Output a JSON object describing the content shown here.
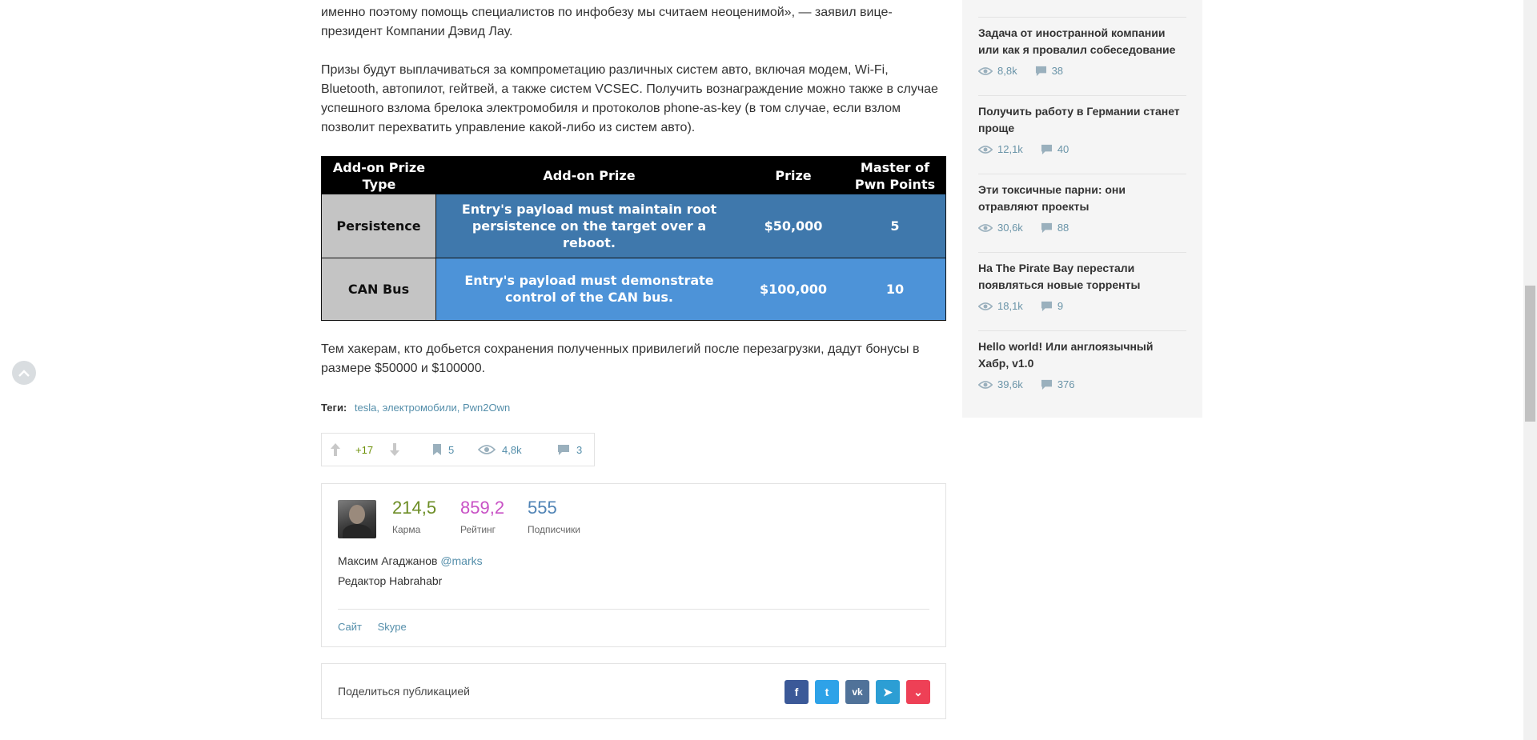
{
  "article": {
    "paragraph_1": "именно поэтому помощь специалистов по инфобезу мы считаем неоценимой», — заявил вице-президент Компании Дэвид Лау.",
    "paragraph_2": "Призы будут выплачиваться за компрометацию различных систем авто, включая модем, Wi-Fi, Bluetooth, автопилот, гейтвей, а также систем VCSEC. Получить вознаграждение можно также в случае успешного взлома брелока электромобиля и протоколов phone-as-key (в том случае, если взлом позволит перехватить управление какой-либо из систем авто).",
    "paragraph_3": "Тем хакерам, кто добьется сохранения полученных привилегий после перезагрузки, дадут бонусы в размере $50000 и $100000.",
    "table": {
      "headers": [
        "Add-on Prize Type",
        "Add-on Prize",
        "Prize",
        "Master of Pwn Points"
      ],
      "rows": [
        [
          "Persistence",
          "Entry's payload must maintain root persistence on the target over a reboot.",
          "$50,000",
          "5"
        ],
        [
          "CAN Bus",
          "Entry's payload must demonstrate control of the CAN bus.",
          "$100,000",
          "10"
        ]
      ]
    },
    "tags_label": "Теги:",
    "tags": [
      "tesla,",
      "электромобили,",
      "Pwn2Own"
    ],
    "stats": {
      "votes": "+17",
      "bookmarks": "5",
      "views": "4,8k",
      "comments": "3"
    }
  },
  "author": {
    "karma": "214,5",
    "karma_label": "Карма",
    "rating": "859,2",
    "rating_label": "Рейтинг",
    "followers": "555",
    "followers_label": "Подписчики",
    "name": "Максим Агаджанов",
    "handle": "@marks",
    "role": "Редактор Habrahabr",
    "links": [
      "Сайт",
      "Skype"
    ]
  },
  "share": {
    "label": "Поделиться публикацией",
    "buttons": [
      {
        "icon": "facebook-icon",
        "glyph": "f",
        "color": "#3b5998"
      },
      {
        "icon": "twitter-icon",
        "glyph": "t",
        "color": "#2ea2e8"
      },
      {
        "icon": "vk-icon",
        "glyph": "vk",
        "color": "#507299"
      },
      {
        "icon": "telegram-icon",
        "glyph": "➤",
        "color": "#2c9ed4"
      },
      {
        "icon": "pocket-icon",
        "glyph": "⌄",
        "color": "#ee4056"
      }
    ]
  },
  "sidebar": {
    "items": [
      {
        "title": "Задача от иностранной компании или как я провалил собеседование",
        "views": "8,8k",
        "comments": "38"
      },
      {
        "title": "Получить работу в Германии станет проще",
        "views": "12,1k",
        "comments": "40"
      },
      {
        "title": "Эти токсичные парни: они отравляют проекты",
        "views": "30,6k",
        "comments": "88"
      },
      {
        "title": "На The Pirate Bay перестали появляться новые торренты",
        "views": "18,1k",
        "comments": "9"
      },
      {
        "title": "Hello world! Или англоязычный Хабр, v1.0",
        "views": "39,6k",
        "comments": "376"
      }
    ]
  },
  "colors": {
    "link": "#548eaa",
    "positive": "#6c9007",
    "karma": "#6c8d25",
    "rating": "#c851c5",
    "followers": "#4f83b5"
  }
}
